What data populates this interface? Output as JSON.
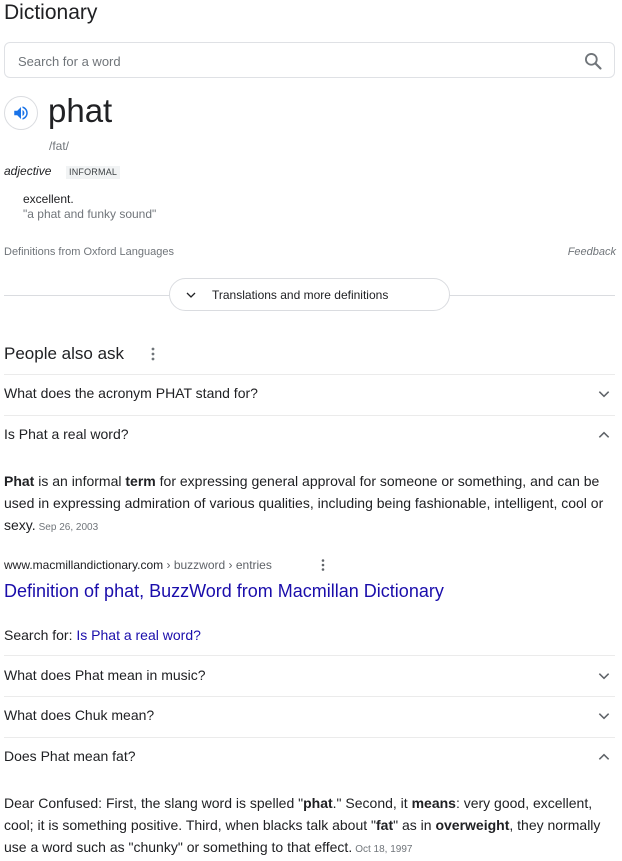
{
  "dictionary": {
    "title": "Dictionary",
    "search": {
      "placeholder": "Search for a word",
      "value": ""
    },
    "entry": {
      "word": "phat",
      "phonetic": "/fat/",
      "part_of_speech": "adjective",
      "register": "INFORMAL",
      "definition": "excellent.",
      "example": "\"a phat and funky sound\""
    },
    "source": "Definitions from Oxford Languages",
    "feedback": "Feedback",
    "more_button": "Translations and more definitions"
  },
  "people_also_ask": {
    "title": "People also ask",
    "questions": [
      {
        "text": "What does the acronym PHAT stand for?",
        "expanded": false
      },
      {
        "text": "Is Phat a real word?",
        "expanded": true
      },
      {
        "text": "What does Phat mean in music?",
        "expanded": false
      },
      {
        "text": "What does Chuk mean?",
        "expanded": false
      },
      {
        "text": "Does Phat mean fat?",
        "expanded": true
      }
    ],
    "answer1": {
      "bold_lead": "Phat",
      "part1": " is an informal ",
      "bold_term": "term",
      "part2": " for expressing general approval for someone or something, and can be used in expressing admiration of various qualities, including being fashionable, intelligent, cool or sexy.",
      "date": "Sep 26, 2003",
      "cite_domain": "www.macmillandictionary.com",
      "cite_path": " › buzzword › entries",
      "link_title": "Definition of phat, BuzzWord from Macmillan Dictionary",
      "search_for_label": "Search for: ",
      "search_for_link": "Is Phat a real word?"
    },
    "answer2": {
      "t1": "Dear Confused: First, the slang word is spelled \"",
      "b1": "phat",
      "t2": ".\" Second, it ",
      "b2": "means",
      "t3": ": very good, excellent, cool; it is something positive. Third, when blacks talk about \"",
      "b3": "fat",
      "t4": "\" as in ",
      "b4": "overweight",
      "t5": ", they normally use a word such as \"chunky\" or something to that effect.",
      "date": "Oct 18, 1997"
    }
  },
  "colors": {
    "link": "#1a0dab",
    "text": "#202124",
    "secondary": "#70757a",
    "speaker_icon": "#1a73e8"
  }
}
